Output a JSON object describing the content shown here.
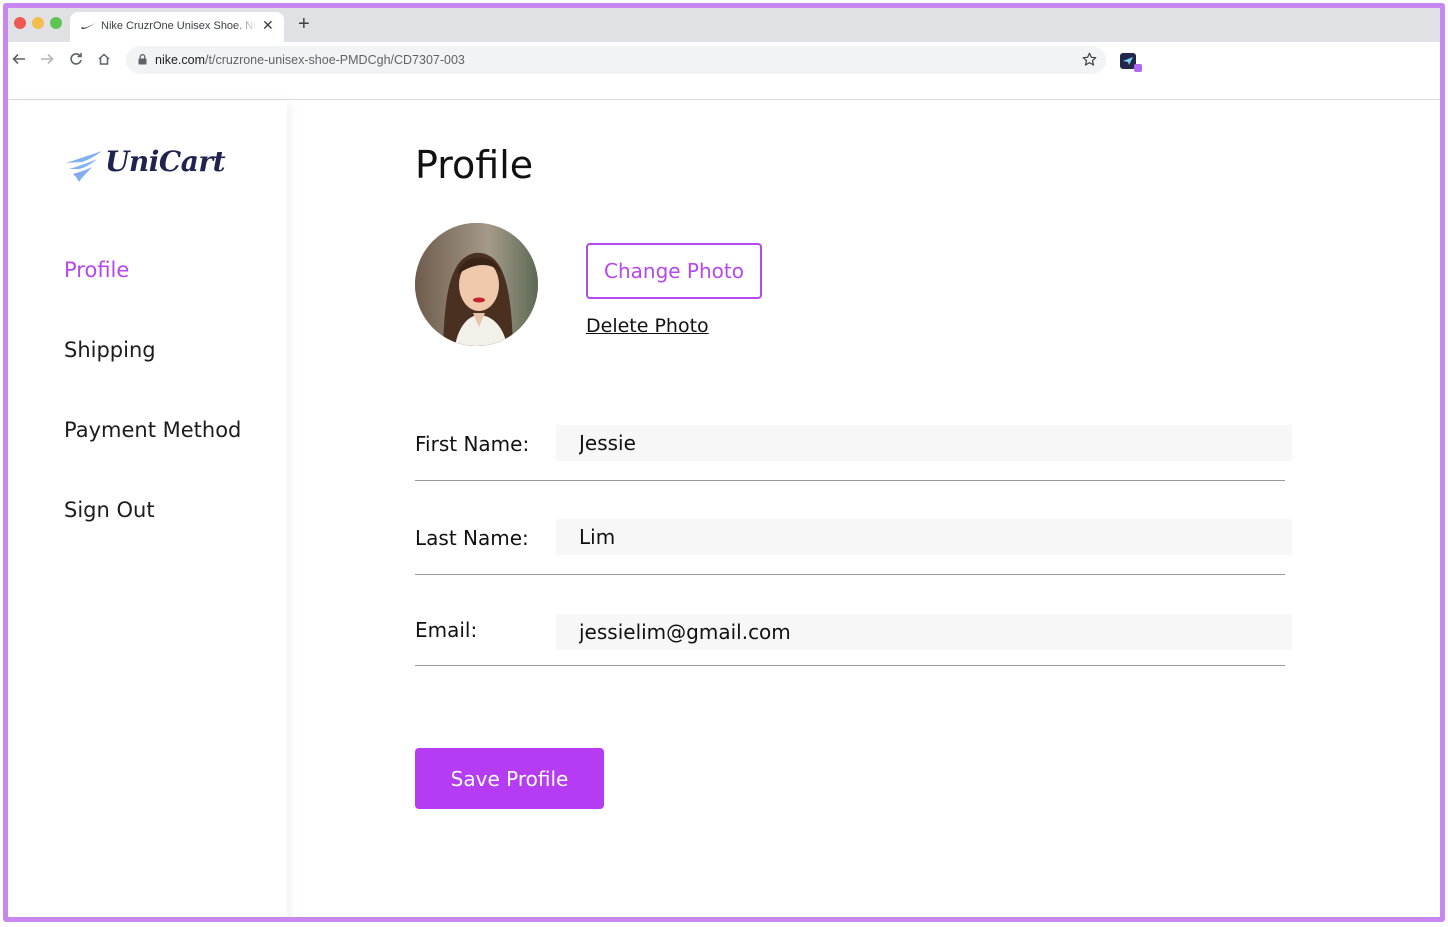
{
  "browser": {
    "tab_title": "Nike CruzrOne Unisex Shoe. Nike.com",
    "tab_favicon": "nike-swoosh-icon",
    "url_host": "nike.com",
    "url_path": "/t/cruzrone-unisex-shoe-PMDCgh/CD7307-003",
    "new_tab_label": "+",
    "close_tab_label": "✕"
  },
  "sidebar": {
    "logo_text": "UniCart",
    "items": [
      {
        "label": "Profile",
        "active": true
      },
      {
        "label": "Shipping",
        "active": false
      },
      {
        "label": "Payment Method",
        "active": false
      },
      {
        "label": "Sign Out",
        "active": false
      }
    ]
  },
  "main": {
    "title": "Profile",
    "change_photo_label": "Change Photo",
    "delete_photo_label": "Delete Photo",
    "fields": {
      "first_name": {
        "label": "First Name:",
        "value": "Jessie"
      },
      "last_name": {
        "label": "Last Name:",
        "value": "Lim"
      },
      "email": {
        "label": "Email:",
        "value": "jessielim@gmail.com"
      }
    },
    "save_label": "Save Profile"
  },
  "colors": {
    "accent": "#b548ee",
    "button": "#b63cf3",
    "frame_border": "#c987f2",
    "logo_text": "#1f2350"
  }
}
